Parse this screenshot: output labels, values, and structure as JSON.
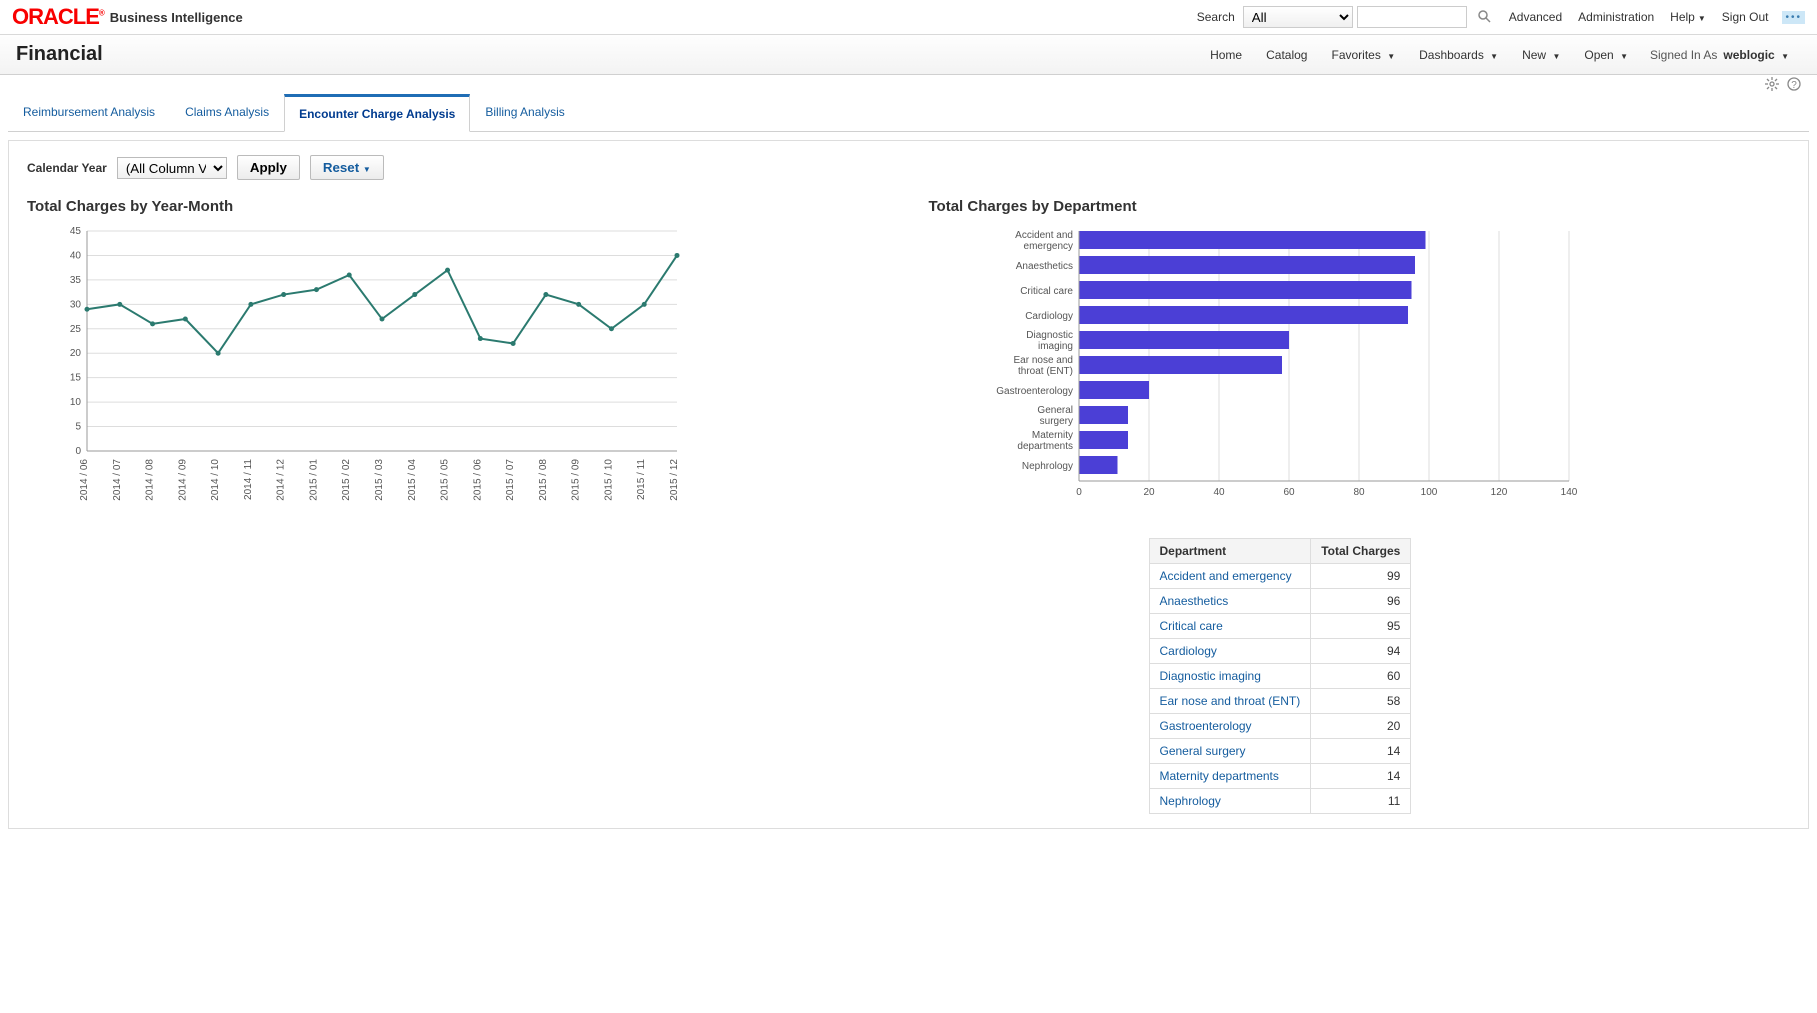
{
  "header": {
    "logo": "ORACLE",
    "brand_sub": "Business Intelligence",
    "search_label": "Search",
    "search_select_value": "All",
    "links": {
      "advanced": "Advanced",
      "administration": "Administration",
      "help": "Help",
      "sign_out": "Sign Out"
    }
  },
  "nav": {
    "page_title": "Financial",
    "home": "Home",
    "catalog": "Catalog",
    "favorites": "Favorites",
    "dashboards": "Dashboards",
    "new": "New",
    "open": "Open",
    "signed_in_as": "Signed In As",
    "user": "weblogic"
  },
  "tabs": [
    {
      "label": "Reimbursement Analysis",
      "active": false
    },
    {
      "label": "Claims Analysis",
      "active": false
    },
    {
      "label": "Encounter Charge Analysis",
      "active": true
    },
    {
      "label": "Billing Analysis",
      "active": false
    }
  ],
  "prompts": {
    "calendar_year_label": "Calendar Year",
    "calendar_year_value": "(All Column Values)",
    "apply": "Apply",
    "reset": "Reset"
  },
  "chart_data": [
    {
      "type": "line",
      "title": "Total Charges by Year-Month",
      "x": [
        "2014 / 06",
        "2014 / 07",
        "2014 / 08",
        "2014 / 09",
        "2014 / 10",
        "2014 / 11",
        "2014 / 12",
        "2015 / 01",
        "2015 / 02",
        "2015 / 03",
        "2015 / 04",
        "2015 / 05",
        "2015 / 06",
        "2015 / 07",
        "2015 / 08",
        "2015 / 09",
        "2015 / 10",
        "2015 / 11",
        "2015 / 12"
      ],
      "values": [
        29,
        30,
        26,
        27,
        20,
        30,
        32,
        33,
        36,
        27,
        32,
        37,
        23,
        22,
        32,
        30,
        25,
        30,
        40
      ],
      "ylim": [
        0,
        45
      ],
      "y_ticks": [
        0,
        5,
        10,
        15,
        20,
        25,
        30,
        35,
        40,
        45
      ]
    },
    {
      "type": "bar",
      "orientation": "horizontal",
      "title": "Total Charges by Department",
      "categories": [
        "Accident and emergency",
        "Anaesthetics",
        "Critical care",
        "Cardiology",
        "Diagnostic imaging",
        "Ear nose and throat (ENT)",
        "Gastroenterology",
        "General surgery",
        "Maternity departments",
        "Nephrology"
      ],
      "values": [
        99,
        96,
        95,
        94,
        60,
        58,
        20,
        14,
        14,
        11
      ],
      "xlim": [
        0,
        140
      ],
      "x_ticks": [
        0,
        20,
        40,
        60,
        80,
        100,
        120,
        140
      ]
    }
  ],
  "table": {
    "headers": [
      "Department",
      "Total Charges"
    ],
    "rows": [
      {
        "dept": "Accident and emergency",
        "charges": 99
      },
      {
        "dept": "Anaesthetics",
        "charges": 96
      },
      {
        "dept": "Critical care",
        "charges": 95
      },
      {
        "dept": "Cardiology",
        "charges": 94
      },
      {
        "dept": "Diagnostic imaging",
        "charges": 60
      },
      {
        "dept": "Ear nose and throat (ENT)",
        "charges": 58
      },
      {
        "dept": "Gastroenterology",
        "charges": 20
      },
      {
        "dept": "General surgery",
        "charges": 14
      },
      {
        "dept": "Maternity departments",
        "charges": 14
      },
      {
        "dept": "Nephrology",
        "charges": 11
      }
    ]
  }
}
